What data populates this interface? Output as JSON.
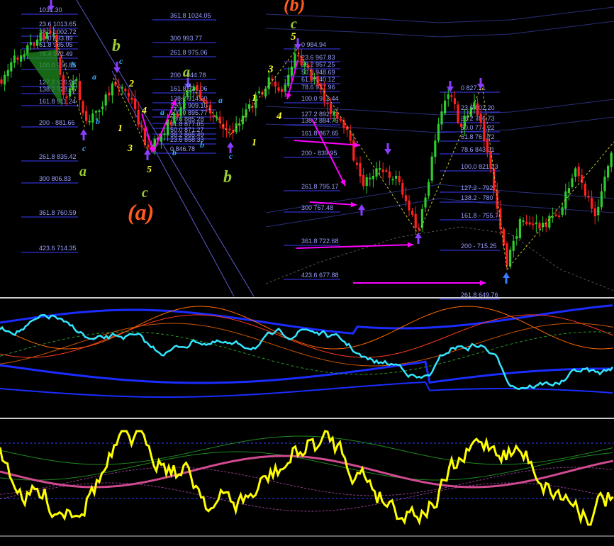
{
  "colors": {
    "background": "#000000",
    "candle_up": "#2ecc2e",
    "candle_down": "#ff2020",
    "fib_line": "#3b3bff",
    "fib_text": "#9aa0ff",
    "arrow_purple": "#8a3cff",
    "arrow_blue": "#3a7bff",
    "magenta": "#ff00ff",
    "wave_yellow": "#ffff33",
    "wave_green": "#9acd32",
    "wave_cyan": "#33aaff",
    "wave_orange": "#ff5a1e",
    "indicator_cyan": "#33e6ff",
    "indicator_blue": "#1a2cff",
    "oscillator_yellow": "#ffff00",
    "oscillator_pink": "#d04a90"
  },
  "main_chart": {
    "left_fib_levels": [
      {
        "text": "1031.30"
      },
      {
        "text": "23.6 1013.65"
      },
      {
        "text": "38.2 1002.72"
      },
      {
        "text": "50.0 993.89"
      },
      {
        "text": "61.8 985.05"
      },
      {
        "text": "76.4 972.49"
      },
      {
        "text": "100.0 956.85"
      },
      {
        "text": "127.2 936.24"
      },
      {
        "text": "138.2 928.25"
      },
      {
        "text": "161.8 911.24"
      },
      {
        "text": "200 - 881.66"
      },
      {
        "text": "261.8 835.42"
      },
      {
        "text": "300 806.83"
      },
      {
        "text": "361.8 760.59"
      },
      {
        "text": "423.6 714.35"
      }
    ],
    "middle_fib_levels": [
      {
        "text": "361.8 1024.05"
      },
      {
        "text": "300 993.77"
      },
      {
        "text": "261.8 975.06"
      },
      {
        "text": "200 - 944.78"
      },
      {
        "text": "161.8 926.06"
      },
      {
        "text": "138.2 914.50"
      },
      {
        "text": "127.2 909.10"
      },
      {
        "text": "100.0 895.77"
      },
      {
        "text": "78.6 885.28"
      },
      {
        "text": "61.8 877.05"
      },
      {
        "text": "50.0 871.27"
      },
      {
        "text": "38.2 865.49"
      },
      {
        "text": "23.6 858.33"
      },
      {
        "text": "0 846.78"
      }
    ],
    "right_fib_levels": [
      {
        "text": "0 984.94"
      },
      {
        "text": "23.6 967.83"
      },
      {
        "text": "38.2 957.25"
      },
      {
        "text": "50.0 948.69"
      },
      {
        "text": "61.8 940.12"
      },
      {
        "text": "78.6 927.96"
      },
      {
        "text": "100.0 912.44"
      },
      {
        "text": "127.2 892.72"
      },
      {
        "text": "138.2 884.75"
      },
      {
        "text": "161.8 867.65"
      },
      {
        "text": "200 - 839.95"
      },
      {
        "text": "261.8 795.17"
      },
      {
        "text": "300 767.48"
      },
      {
        "text": "361.8 722.68"
      },
      {
        "text": "423.6 677.88"
      }
    ],
    "far_right_fib_levels": [
      {
        "text": "0 827.21"
      },
      {
        "text": "23.6 802.20"
      },
      {
        "text": "38.2 786.73"
      },
      {
        "text": "50.0 774.22"
      },
      {
        "text": "61.8 761.72"
      },
      {
        "text": "78.6 843.91"
      },
      {
        "text": "100.0 821.23"
      },
      {
        "text": "127.2 - 792"
      },
      {
        "text": "138.2 - 780"
      },
      {
        "text": "161.8 - 755.74"
      },
      {
        "text": "200 - 715.25"
      },
      {
        "text": "261.8 649.76"
      }
    ],
    "wave_labels": [
      {
        "text": "(b)",
        "color": "#ff5a1e"
      },
      {
        "text": "(a)",
        "color": "#ff5a1e"
      },
      {
        "text": "b",
        "color": "#9acd32"
      },
      {
        "text": "a",
        "color": "#9acd32"
      },
      {
        "text": "c",
        "color": "#9acd32"
      },
      {
        "text": "b",
        "color": "#9acd32"
      },
      {
        "text": "a",
        "color": "#9acd32"
      },
      {
        "text": "c",
        "color": "#9acd32"
      },
      {
        "text": "5",
        "color": "#ffff33"
      },
      {
        "text": "3",
        "color": "#ffff33"
      },
      {
        "text": "4",
        "color": "#ffff33"
      },
      {
        "text": "1",
        "color": "#ffff33"
      },
      {
        "text": "1",
        "color": "#ffff33"
      },
      {
        "text": "2",
        "color": "#ffff33"
      },
      {
        "text": "3",
        "color": "#ffff33"
      },
      {
        "text": "4",
        "color": "#ffff33"
      },
      {
        "text": "5",
        "color": "#ffff33"
      },
      {
        "text": "1",
        "color": "#ffff33"
      },
      {
        "text": "a",
        "color": "#33aaff"
      },
      {
        "text": "b",
        "color": "#33aaff"
      },
      {
        "text": "c",
        "color": "#33aaff"
      },
      {
        "text": "a",
        "color": "#33aaff"
      },
      {
        "text": "b",
        "color": "#33aaff"
      },
      {
        "text": "c",
        "color": "#33aaff"
      },
      {
        "text": "a",
        "color": "#33aaff"
      },
      {
        "text": "b",
        "color": "#33aaff"
      },
      {
        "text": "c",
        "color": "#33aaff"
      },
      {
        "text": "a",
        "color": "#33aaff"
      },
      {
        "text": "b",
        "color": "#33aaff"
      }
    ]
  },
  "chart_data": [
    {
      "type": "candlestick",
      "title": "",
      "xlabel": "",
      "ylabel": "",
      "grid": false,
      "ylim": [
        640,
        1040
      ],
      "annotations": [
        "Elliott wave labels",
        "Fibonacci projection levels",
        "Magenta arrows pointing to 300, 361.8 and 423.6 levels"
      ],
      "swing_points": [
        {
          "label": "high",
          "value": 1031.3
        },
        {
          "label": "(a) low",
          "value": 846.78
        },
        {
          "label": "(b) high",
          "value": 984.94
        },
        {
          "label": "low",
          "value": 722.68
        },
        {
          "label": "high",
          "value": 827.21
        },
        {
          "label": "low",
          "value": 677.88
        }
      ]
    },
    {
      "type": "line",
      "title": "",
      "xlabel": "",
      "ylabel": "",
      "series_count": 9,
      "description_panel": "price indicator panel with bands"
    },
    {
      "type": "line",
      "title": "",
      "xlabel": "",
      "ylabel": "",
      "series_count": 6,
      "description_panel": "oscillator panel"
    }
  ]
}
